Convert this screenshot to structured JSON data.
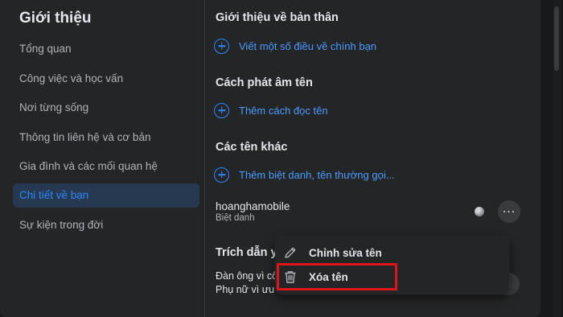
{
  "sidebar": {
    "title": "Giới thiệu",
    "items": [
      {
        "label": "Tổng quan"
      },
      {
        "label": "Công việc và học vấn"
      },
      {
        "label": "Nơi từng sống"
      },
      {
        "label": "Thông tin liên hệ và cơ bản"
      },
      {
        "label": "Gia đình và các mối quan hệ"
      },
      {
        "label": "Chi tiết về bạn",
        "active": true
      },
      {
        "label": "Sự kiện trong đời"
      }
    ]
  },
  "main": {
    "about": {
      "title": "Giới thiệu về bản thân",
      "add_label": "Viết một số điều về chính bạn"
    },
    "pronunciation": {
      "title": "Cách phát âm tên",
      "add_label": "Thêm cách đọc tên"
    },
    "other_names": {
      "title": "Các tên khác",
      "add_label": "Thêm biệt danh, tên thường gọi...",
      "entry": {
        "name": "hoanghamobile",
        "type": "Biệt danh"
      }
    },
    "quotes": {
      "title_partial": "Trích dẫn yê",
      "line1": "Đàn ông vì cô",
      "line2": "Phụ nữ vì ưu"
    }
  },
  "menu": {
    "edit_label": "Chỉnh sửa tên",
    "delete_label": "Xóa tên"
  },
  "colors": {
    "accent": "#2d88ff",
    "highlight_box": "#e0141b",
    "background": "#242526"
  }
}
